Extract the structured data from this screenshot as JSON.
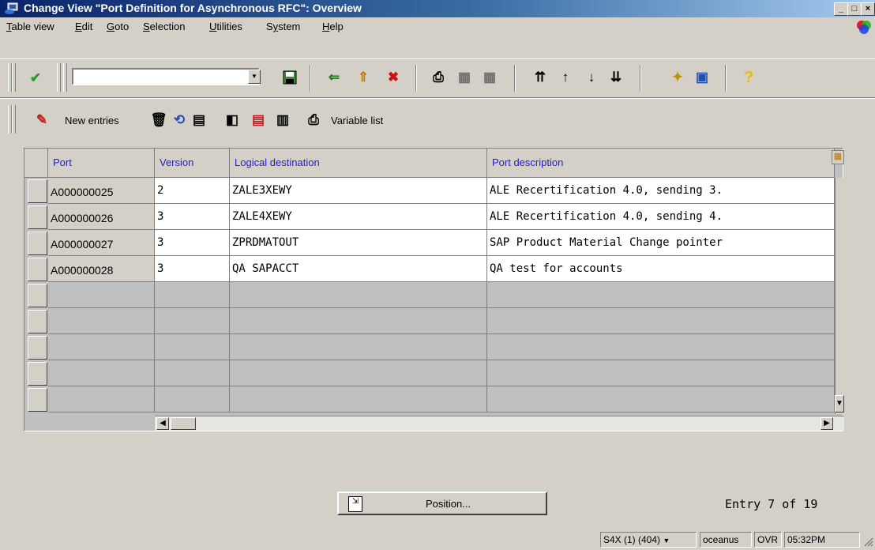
{
  "window": {
    "title": "Change View \"Port Definition for Asynchronous RFC\": Overview",
    "min": "_",
    "max": "□",
    "close": "×"
  },
  "menu": [
    {
      "label": "Table view",
      "underline": "T",
      "rest": "able view"
    },
    {
      "label": "Edit",
      "underline": "E",
      "rest": "dit"
    },
    {
      "label": "Goto",
      "underline": "G",
      "rest": "oto"
    },
    {
      "label": "Selection",
      "underline": "S",
      "rest": "election"
    },
    {
      "label": "Utilities",
      "underline": "U",
      "rest": "tilities"
    },
    {
      "label": "System",
      "underline": "y",
      "pre": "S",
      "rest": "stem"
    },
    {
      "label": "Help",
      "underline": "H",
      "rest": "elp"
    }
  ],
  "standard_toolbar": {
    "command_value": "",
    "icons": [
      "enter-icon",
      "save-icon",
      "back-icon",
      "exit-icon",
      "cancel-icon",
      "print-icon",
      "find-icon",
      "find-next-icon",
      "first-page-icon",
      "previous-page-icon",
      "next-page-icon",
      "last-page-icon",
      "create-session-icon",
      "shortcut-icon",
      "help-icon"
    ]
  },
  "app_toolbar": {
    "new_entries": "New entries",
    "variable_list": "Variable list"
  },
  "table": {
    "columns": [
      "Port",
      "Version",
      "Logical destination",
      "Port description"
    ],
    "rows": [
      {
        "port": "A000000025",
        "version": "2",
        "dest": "ZALE3XEWY",
        "desc": "ALE Recertification 4.0, sending 3."
      },
      {
        "port": "A000000026",
        "version": "3",
        "dest": "ZALE4XEWY",
        "desc": "ALE Recertification 4.0, sending 4."
      },
      {
        "port": "A000000027",
        "version": "3",
        "dest": "ZPRDMATOUT",
        "desc": "SAP Product Material Change pointer"
      },
      {
        "port": "A000000028",
        "version": "3",
        "dest": "QA SAPACCT",
        "desc": "QA test for accounts"
      }
    ],
    "empty_rows": 5
  },
  "position_button": "Position...",
  "entry_info": "Entry 7 of 19",
  "status": {
    "system": "S4X (1) (404)",
    "server": "oceanus",
    "mode": "OVR",
    "time": "05:32PM"
  }
}
